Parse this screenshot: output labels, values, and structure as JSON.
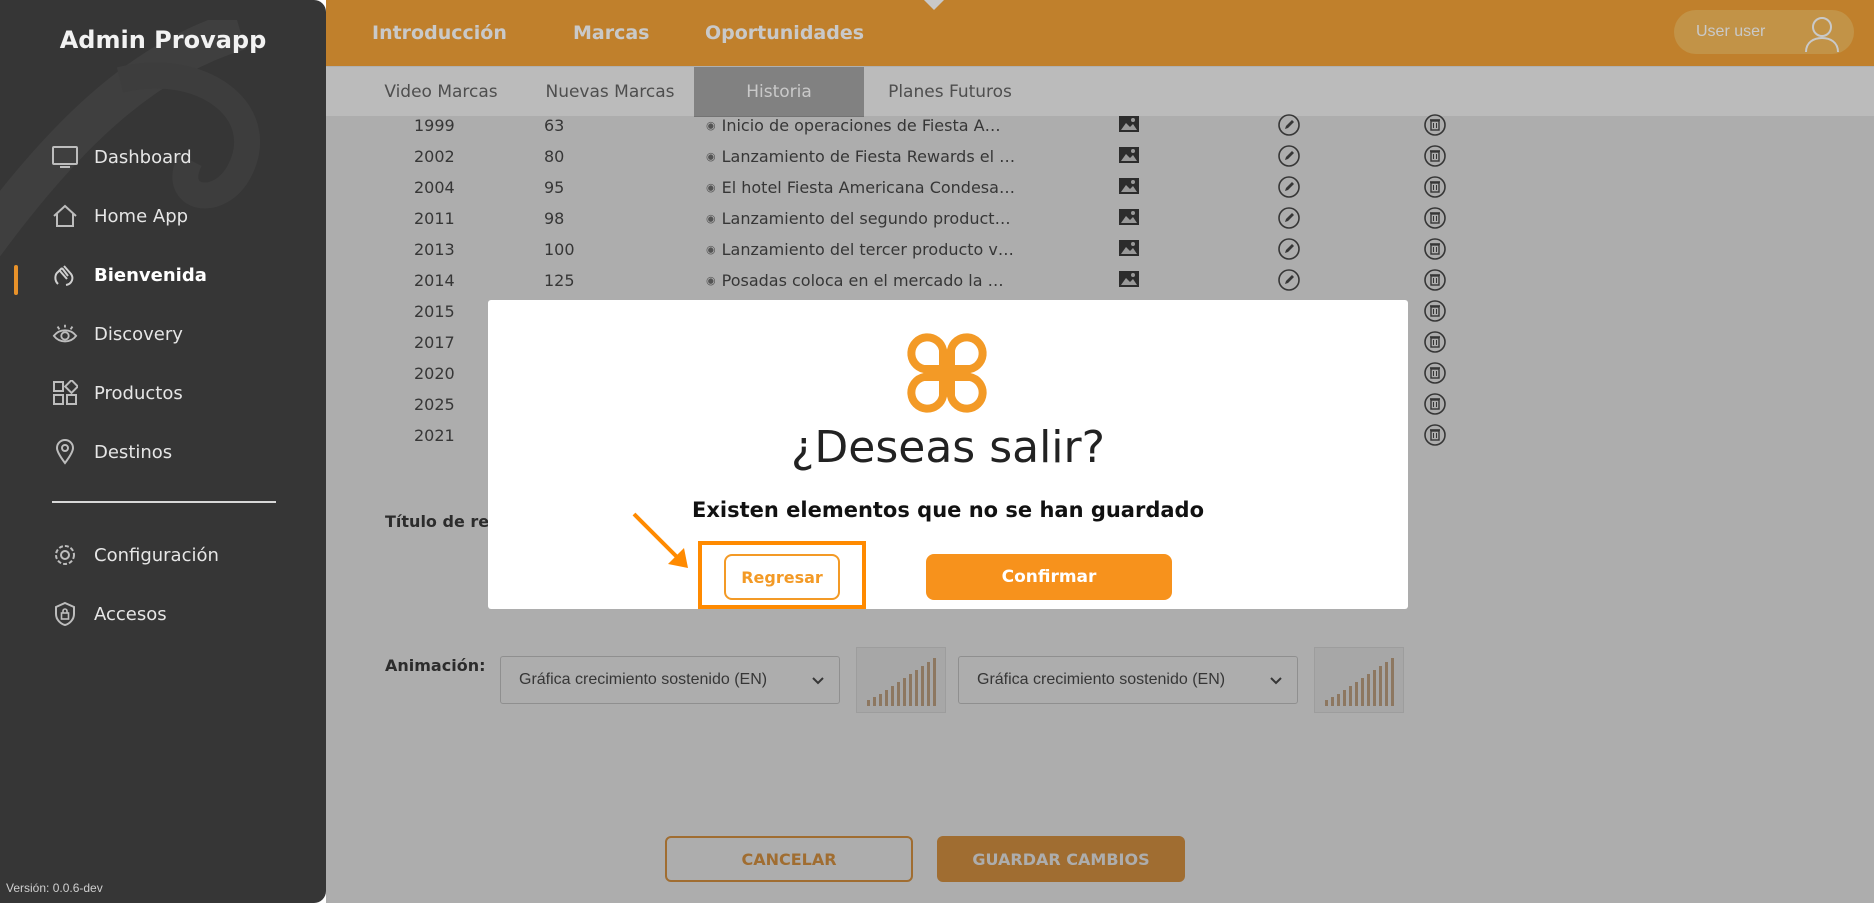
{
  "sidebar": {
    "brand": "Admin Provapp",
    "items": [
      {
        "label": "Dashboard",
        "icon": "monitor-icon"
      },
      {
        "label": "Home App",
        "icon": "home-icon"
      },
      {
        "label": "Bienvenida",
        "icon": "waving-hand-icon",
        "active": true
      },
      {
        "label": "Discovery",
        "icon": "eye-icon"
      },
      {
        "label": "Productos",
        "icon": "grid-icon"
      },
      {
        "label": "Destinos",
        "icon": "map-pin-icon"
      },
      {
        "label": "Configuración",
        "icon": "gear-icon"
      },
      {
        "label": "Accesos",
        "icon": "lock-icon"
      }
    ],
    "version": "Versión: 0.0.6-dev"
  },
  "topnav": {
    "items": [
      "Introducción",
      "Marcas",
      "Oportunidades"
    ],
    "active": "Marcas",
    "user": "User user"
  },
  "subtabs": {
    "items": [
      "Video Marcas",
      "Nuevas Marcas",
      "Historia",
      "Planes Futuros"
    ],
    "active": "Historia"
  },
  "table": {
    "rows": [
      {
        "year": "1999",
        "value": "63",
        "desc": "Inicio de operaciones de Fiesta Amer..."
      },
      {
        "year": "2002",
        "value": "80",
        "desc": "Lanzamiento de Fiesta Rewards el pr..."
      },
      {
        "year": "2004",
        "value": "95",
        "desc": "El hotel Fiesta Americana Condesa A..."
      },
      {
        "year": "2011",
        "value": "98",
        "desc": "Lanzamiento del segundo producto v..."
      },
      {
        "year": "2013",
        "value": "100",
        "desc": "Lanzamiento del tercer producto vac..."
      },
      {
        "year": "2014",
        "value": "125",
        "desc": "Posadas coloca en el mercado la ma..."
      },
      {
        "year": "2015",
        "value": "",
        "desc": ""
      },
      {
        "year": "2017",
        "value": "",
        "desc": ""
      },
      {
        "year": "2020",
        "value": "",
        "desc": ""
      },
      {
        "year": "2025",
        "value": "",
        "desc": ""
      },
      {
        "year": "2021",
        "value": "",
        "desc": ""
      }
    ]
  },
  "form": {
    "summary_label": "Título de resu",
    "animation_label": "Animación:",
    "animation_select_1": "Gráfica crecimiento sostenido (EN)",
    "animation_select_2": "Gráfica crecimiento sostenido (EN)"
  },
  "footer": {
    "cancel_label": "CANCELAR",
    "save_label": "GUARDAR CAMBIOS"
  },
  "modal": {
    "title": "¿Deseas salir?",
    "message": "Existen elementos que no se han guardado",
    "back_label": "Regresar",
    "confirm_label": "Confirmar"
  },
  "colors": {
    "accent": "#f39a26",
    "sidebar": "#363636"
  }
}
